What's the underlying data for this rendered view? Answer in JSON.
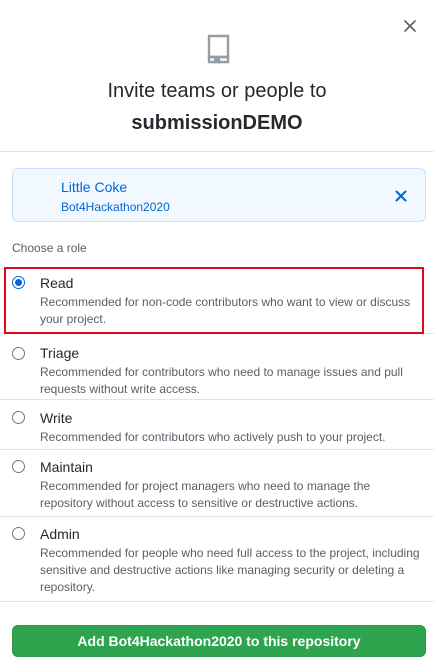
{
  "dialog": {
    "title": "Invite teams or people to",
    "repo_name": "submissionDEMO",
    "close_icon": "close-icon",
    "repo_icon": "repo-icon"
  },
  "invitee": {
    "name": "Little Coke",
    "username": "Bot4Hackathon2020",
    "remove_icon": "close-icon"
  },
  "roles": {
    "heading": "Choose a role",
    "selected": "Read",
    "items": [
      {
        "name": "Read",
        "description": "Recommended for non-code contributors who want to view or discuss your project."
      },
      {
        "name": "Triage",
        "description": "Recommended for contributors who need to manage issues and pull requests without write access."
      },
      {
        "name": "Write",
        "description": "Recommended for contributors who actively push to your project."
      },
      {
        "name": "Maintain",
        "description": "Recommended for project managers who need to manage the repository without access to sensitive or destructive actions."
      },
      {
        "name": "Admin",
        "description": "Recommended for people who need full access to the project, including sensitive and destructive actions like managing security or deleting a repository."
      }
    ]
  },
  "submit": {
    "label": "Add Bot4Hackathon2020 to this repository"
  },
  "colors": {
    "accent": "#0366d6",
    "button": "#2ea44f",
    "highlight": "#e0081a"
  }
}
